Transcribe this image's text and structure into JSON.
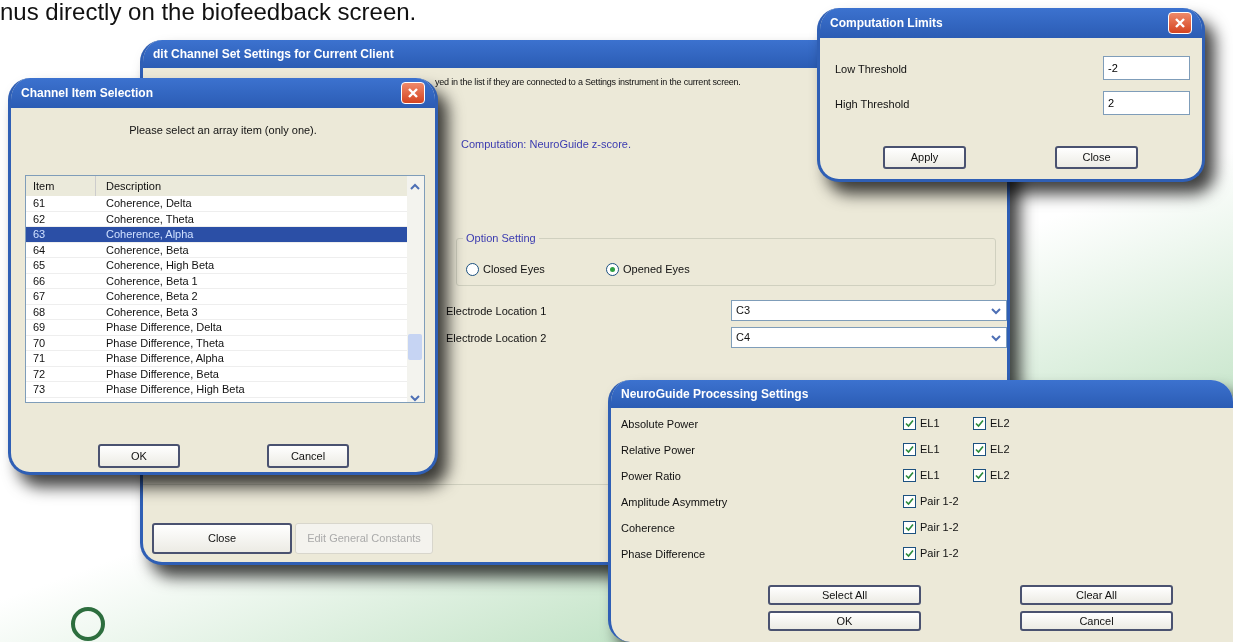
{
  "caption": "nus directly on the biofeedback screen.",
  "main_window": {
    "title": "dit Channel Set Settings for Current Client",
    "note": "yed in the list if they are connected to a Settings instrument in the current screen.",
    "computation": "Computation: NeuroGuide z-score.",
    "option_group": {
      "title": "Option Setting",
      "options": [
        {
          "label": "Closed Eyes",
          "selected": false
        },
        {
          "label": "Opened Eyes",
          "selected": true
        }
      ]
    },
    "electrodes": [
      {
        "label": "Electrode Location 1",
        "value": "C3"
      },
      {
        "label": "Electrode Location 2",
        "value": "C4"
      }
    ],
    "buttons": [
      {
        "label": "Close",
        "disabled": false
      },
      {
        "label": "Edit General Constants",
        "disabled": true
      }
    ]
  },
  "item_dialog": {
    "title": "Channel Item Selection",
    "prompt": "Please select an array item (only one).",
    "columns": [
      "Item",
      "Description"
    ],
    "rows": [
      {
        "item": "61",
        "description": "Coherence, Delta",
        "selected": false
      },
      {
        "item": "62",
        "description": "Coherence, Theta",
        "selected": false
      },
      {
        "item": "63",
        "description": "Coherence, Alpha",
        "selected": true
      },
      {
        "item": "64",
        "description": "Coherence, Beta",
        "selected": false
      },
      {
        "item": "65",
        "description": "Coherence, High Beta",
        "selected": false
      },
      {
        "item": "66",
        "description": "Coherence, Beta 1",
        "selected": false
      },
      {
        "item": "67",
        "description": "Coherence, Beta 2",
        "selected": false
      },
      {
        "item": "68",
        "description": "Coherence, Beta 3",
        "selected": false
      },
      {
        "item": "69",
        "description": "Phase Difference, Delta",
        "selected": false
      },
      {
        "item": "70",
        "description": "Phase Difference, Theta",
        "selected": false
      },
      {
        "item": "71",
        "description": "Phase Difference, Alpha",
        "selected": false
      },
      {
        "item": "72",
        "description": "Phase Difference, Beta",
        "selected": false
      },
      {
        "item": "73",
        "description": "Phase Difference, High Beta",
        "selected": false
      }
    ],
    "buttons": [
      "OK",
      "Cancel"
    ]
  },
  "limits_dialog": {
    "title": "Computation Limits",
    "fields": [
      {
        "label": "Low Threshold",
        "value": "-2"
      },
      {
        "label": "High Threshold",
        "value": "2"
      }
    ],
    "buttons": [
      "Apply",
      "Close"
    ]
  },
  "processing_dialog": {
    "title": "NeuroGuide Processing Settings",
    "rows": [
      {
        "label": "Absolute Power",
        "checks": [
          {
            "label": "EL1",
            "checked": true
          },
          {
            "label": "EL2",
            "checked": true
          }
        ]
      },
      {
        "label": "Relative Power",
        "checks": [
          {
            "label": "EL1",
            "checked": true
          },
          {
            "label": "EL2",
            "checked": true
          }
        ]
      },
      {
        "label": "Power Ratio",
        "checks": [
          {
            "label": "EL1",
            "checked": true
          },
          {
            "label": "EL2",
            "checked": true
          }
        ]
      },
      {
        "label": "Amplitude Asymmetry",
        "checks": [
          {
            "label": "Pair 1-2",
            "checked": true
          }
        ]
      },
      {
        "label": "Coherence",
        "checks": [
          {
            "label": "Pair 1-2",
            "checked": true
          }
        ]
      },
      {
        "label": "Phase Difference",
        "checks": [
          {
            "label": "Pair 1-2",
            "checked": true
          }
        ]
      }
    ],
    "buttons": [
      "Select All",
      "Clear All",
      "OK",
      "Cancel"
    ]
  }
}
